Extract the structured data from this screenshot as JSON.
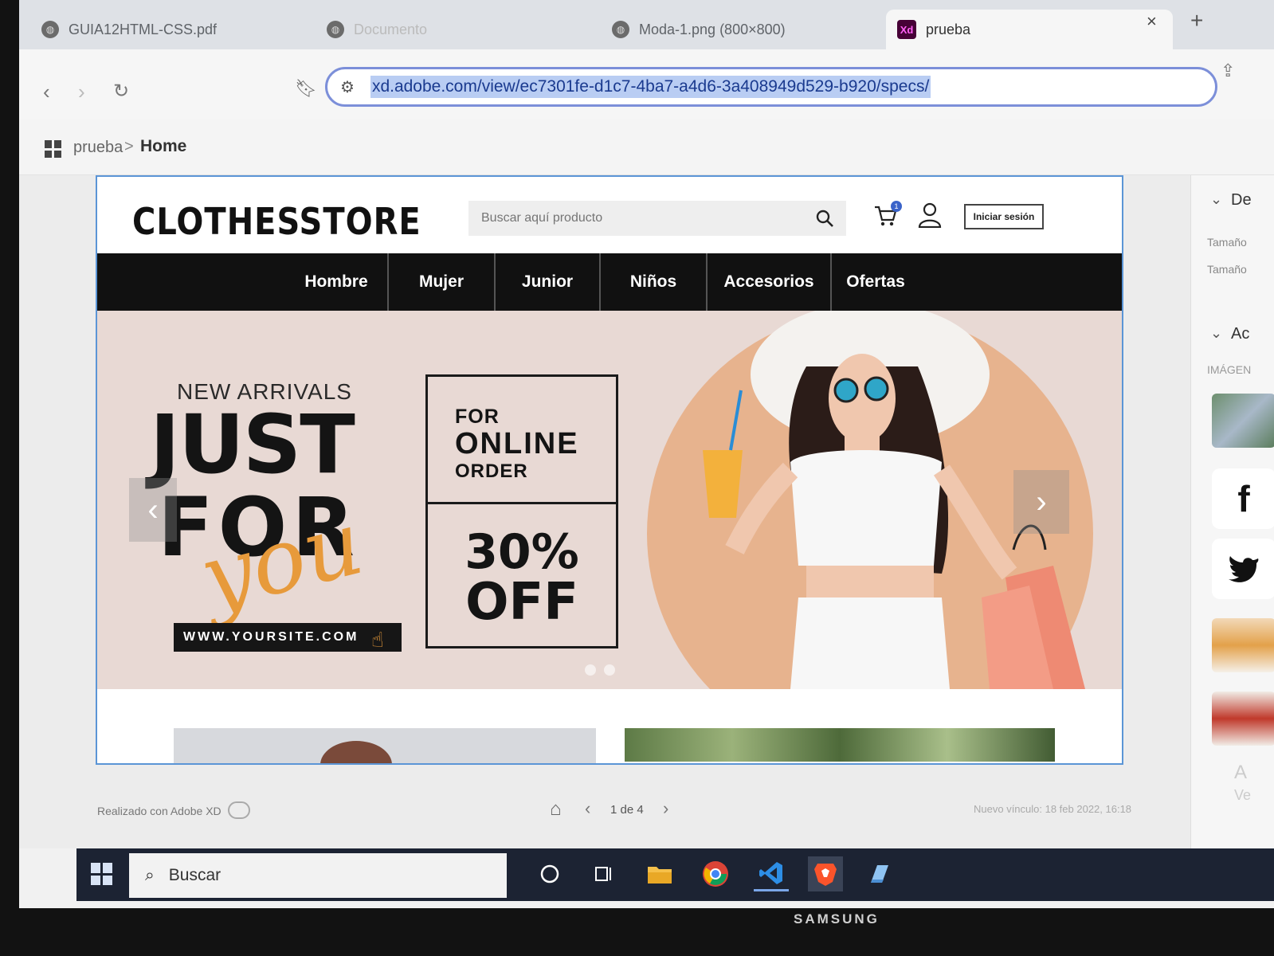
{
  "browser": {
    "tabs": [
      {
        "title": "GUIA12HTML-CSS.pdf"
      },
      {
        "title": "Documento"
      },
      {
        "title": "Moda-1.png (800×800)"
      },
      {
        "title": "prueba",
        "favicon_text": "Xd"
      }
    ],
    "close_glyph": "×",
    "new_tab_glyph": "+",
    "url": "xd.adobe.com/view/ec7301fe-d1c7-4ba7-a4d6-3a408949d529-b920/specs/"
  },
  "xd": {
    "breadcrumb": {
      "project": "prueba",
      "separator": ">",
      "current": "Home"
    },
    "footer": {
      "made_with": "Realizado con Adobe XD",
      "pager": "1 de 4",
      "new_link": "Nuevo vínculo: 18 feb 2022, 16:18"
    },
    "right_panel": {
      "section1": "De",
      "size1": "Tamaño",
      "size2": "Tamaño",
      "section2": "Ac",
      "images_label": "IMÁGEN",
      "facebook_glyph": "f",
      "faded_text": "A",
      "faded_text2": "Ve"
    }
  },
  "site": {
    "logo": "CLOTHESSTORE",
    "search_placeholder": "Buscar aquí producto",
    "cart_count": "1",
    "login_label": "Iniciar sesión",
    "nav": [
      "Hombre",
      "Mujer",
      "Junior",
      "Niños",
      "Accesorios",
      "Ofertas"
    ],
    "hero": {
      "new_arrivals": "NEW ARRIVALS",
      "line1": "JUST",
      "line2": "FOR",
      "script": "you",
      "url": "WWW.YOURSITE.COM",
      "promo_for": "FOR",
      "promo_online": "ONLINE",
      "promo_order": "ORDER",
      "promo_pct": "30%",
      "promo_off": "OFF"
    }
  },
  "taskbar": {
    "search_label": "Buscar"
  },
  "monitor_brand": "SAMSUNG",
  "colors": {
    "accent_blue": "#5b95d6",
    "nav_black": "#111111",
    "hero_bg": "#e8d9d4",
    "hero_circle": "#e7b38e",
    "script_orange": "#e79a3b"
  }
}
